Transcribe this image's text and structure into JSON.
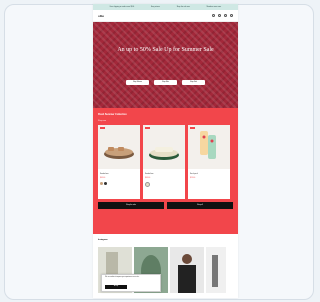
{
  "announcement": {
    "items": [
      "Free shipping on orders over $100",
      "Easy returns",
      "Shop the sale now",
      "Members save more"
    ]
  },
  "header": {
    "logo": "ollie"
  },
  "hero": {
    "title": "An up to 50% Sale Up for Summer Sale",
    "buttons": [
      "Shop Women",
      "Shop Men",
      "Shop Kids"
    ]
  },
  "sale": {
    "title": "Flash Summer Collection",
    "subtitle": "Shop now",
    "products": [
      {
        "badge": "Sale",
        "name": "Sandal one",
        "price": "$49.00",
        "colors": [
          "#c8a07a",
          "#333333"
        ]
      },
      {
        "badge": "Sale",
        "name": "Sandal two",
        "price": "$49.00",
        "colors": [
          "#e6e0c8"
        ]
      },
      {
        "badge": "Sale",
        "name": "Sock pack",
        "price": "$19.00",
        "colors": []
      }
    ],
    "buttons": [
      "Shop the sale",
      "Shop all"
    ]
  },
  "instagram": {
    "title": "Instagram"
  },
  "cookie": {
    "text": "We use cookies to improve your experience on our site.",
    "button": "Accept"
  }
}
